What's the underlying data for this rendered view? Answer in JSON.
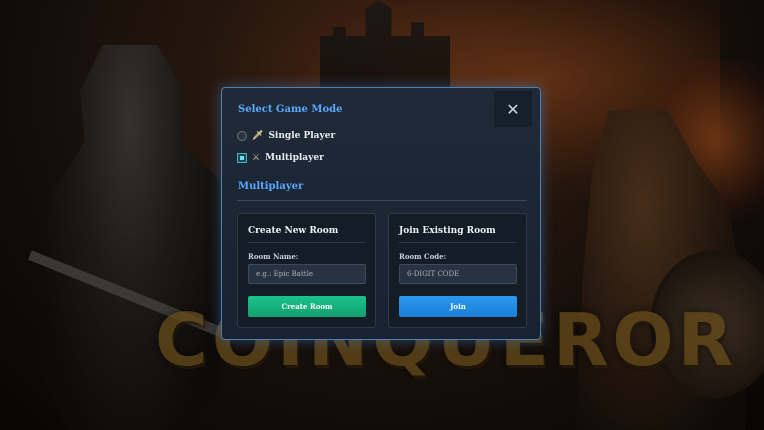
{
  "background": {
    "logo_text": "COINQUEROR"
  },
  "modal": {
    "title": "Select Game Mode",
    "close_icon": "close-icon",
    "close_glyph": "✕",
    "modes": [
      {
        "label": "Single Player",
        "icon": "sword-icon",
        "glyph": "🗡",
        "selected": false
      },
      {
        "label": "Multiplayer",
        "icon": "crossed-swords-icon",
        "glyph": "⚔",
        "selected": true
      }
    ],
    "section_title": "Multiplayer",
    "create_room": {
      "title": "Create New Room",
      "field_label": "Room Name:",
      "placeholder": "e.g.: Epic Battle",
      "button_label": "Create Room"
    },
    "join_room": {
      "title": "Join Existing Room",
      "field_label": "Room Code:",
      "placeholder": "6-DIGIT CODE",
      "button_label": "Join"
    }
  },
  "colors": {
    "accent": "#5aa8ff",
    "create_button": "#1bc38a",
    "join_button": "#2a97ef",
    "modal_border": "#4d7fb0"
  }
}
